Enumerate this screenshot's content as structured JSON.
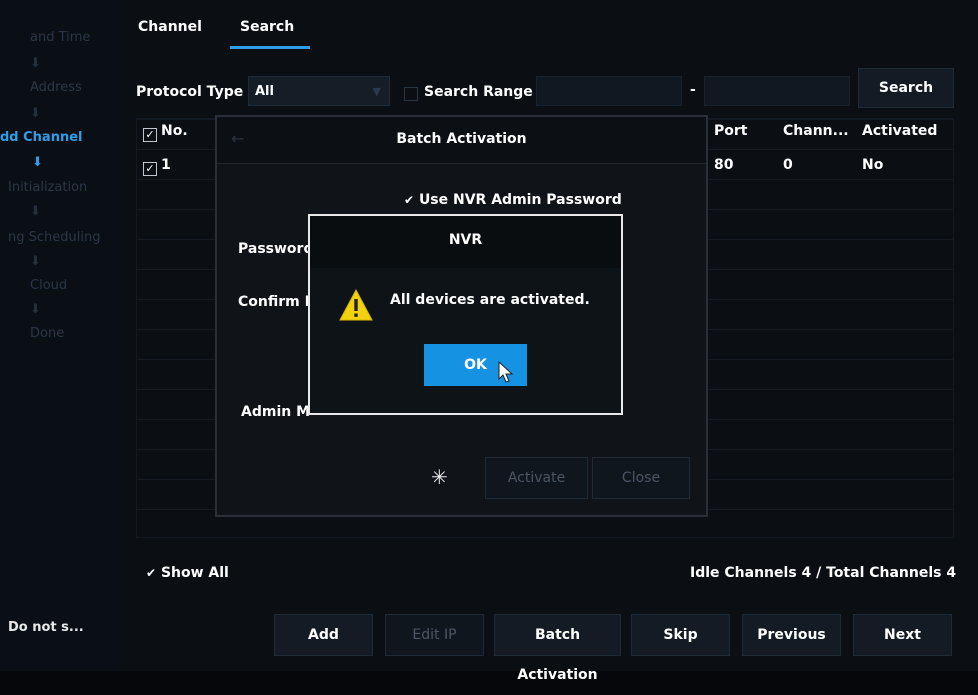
{
  "sidebar": {
    "steps": [
      "and Time",
      "Address",
      "dd Channel",
      "Initialization",
      "ng Scheduling",
      "Cloud",
      "Done"
    ],
    "footer": "Do not s..."
  },
  "tabs": [
    "Channel",
    "Search"
  ],
  "filters": {
    "protocol_label": "Protocol Type",
    "protocol_value": "All",
    "search_range_label": "Search Range",
    "range_dash": "-",
    "search_button": "Search"
  },
  "table": {
    "headers": [
      "No.",
      "Port",
      "Chann...",
      "Activated"
    ],
    "rows": [
      {
        "no": "1",
        "port": "80",
        "channel": "0",
        "activated": "No"
      }
    ]
  },
  "batch_dialog": {
    "back_arrow": "←",
    "title": "Batch Activation",
    "use_nvr_password": "Use NVR Admin Password",
    "password_label": "Password",
    "confirm_label": "Confirm P",
    "admin_label": "Admin M",
    "activate_button": "Activate",
    "close_button": "Close"
  },
  "message_box": {
    "title": "NVR",
    "message": "All devices are activated.",
    "ok_button": "OK",
    "warning_color": "#f2d20f"
  },
  "bottom": {
    "show_all": "Show All",
    "channels_info": "Idle Channels 4 / Total Channels 4",
    "buttons": [
      "Add",
      "Edit IP",
      "Batch Activation",
      "Skip",
      "Previous",
      "Next"
    ]
  }
}
